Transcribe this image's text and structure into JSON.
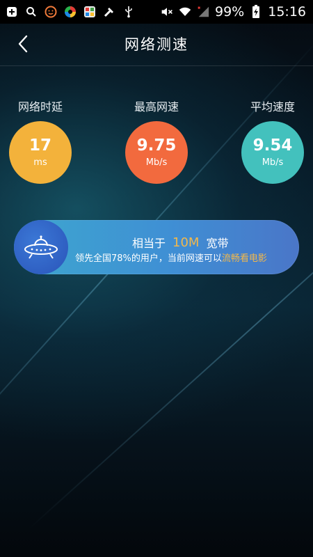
{
  "status_bar": {
    "battery_percent": "99%",
    "time": "15:16",
    "icons": [
      "plus-box-icon",
      "search-icon",
      "smile-icon",
      "app-icon-1",
      "app-icon-2",
      "tools-icon",
      "usb-icon",
      "mute-icon",
      "wifi-icon",
      "signal-icon",
      "battery-charging-icon"
    ]
  },
  "header": {
    "back_icon": "chevron-left-icon",
    "title": "网络测速"
  },
  "stats": [
    {
      "label": "网络时延",
      "value": "17",
      "unit": "ms",
      "color": "#f3b23b"
    },
    {
      "label": "最高网速",
      "value": "9.75",
      "unit": "Mb/s",
      "color": "#f26a3e"
    },
    {
      "label": "平均速度",
      "value": "9.54",
      "unit": "Mb/s",
      "color": "#43c1bd"
    }
  ],
  "banner": {
    "icon": "ufo-icon",
    "line1_prefix": "相当于",
    "line1_highlight": "10M",
    "line1_suffix": "宽带",
    "line2_prefix": "领先全国78%的用户，当前网速可以",
    "line2_highlight": "流畅看电影"
  }
}
